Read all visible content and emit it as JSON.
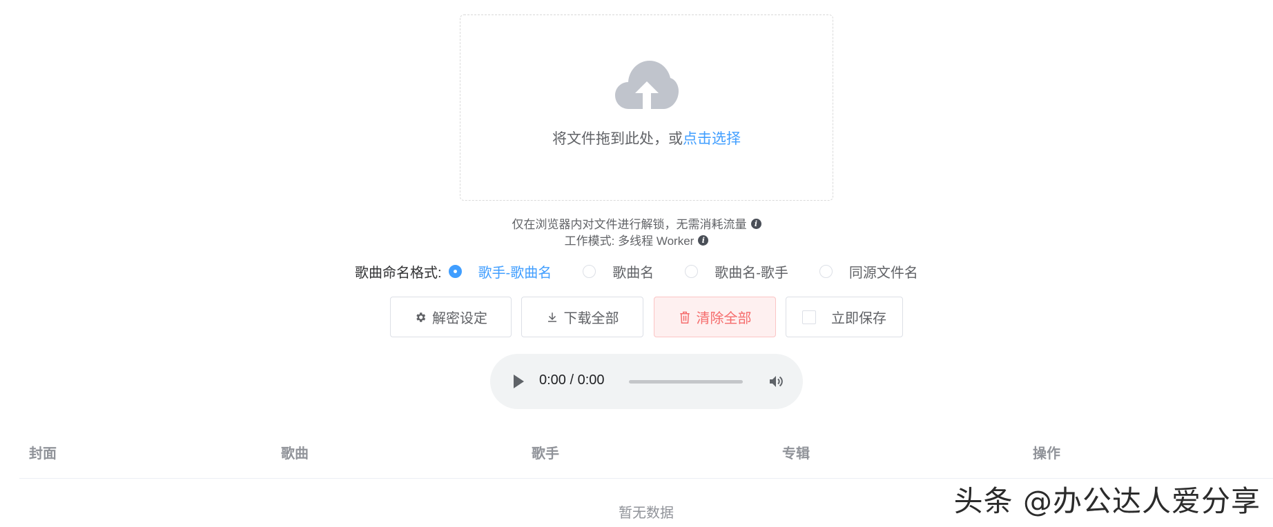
{
  "upload": {
    "icon": "cloud-upload-icon",
    "text_prefix": "将文件拖到此处，或",
    "link_text": "点击选择"
  },
  "info": {
    "line1": "仅在浏览器内对文件进行解锁，无需消耗流量",
    "line2": "工作模式: 多线程 Worker"
  },
  "naming": {
    "label": "歌曲命名格式:",
    "options": [
      {
        "label": "歌手-歌曲名",
        "checked": true
      },
      {
        "label": "歌曲名",
        "checked": false
      },
      {
        "label": "歌曲名-歌手",
        "checked": false
      },
      {
        "label": "同源文件名",
        "checked": false
      }
    ]
  },
  "buttons": {
    "settings": "解密设定",
    "download_all": "下载全部",
    "clear_all": "清除全部",
    "save_now": "立即保存"
  },
  "audio": {
    "time": "0:00 / 0:00"
  },
  "table": {
    "columns": [
      "封面",
      "歌曲",
      "歌手",
      "专辑",
      "操作"
    ],
    "empty_text": "暂无数据"
  },
  "watermark": "头条 @办公达人爱分享",
  "colors": {
    "primary": "#409eff",
    "danger": "#f56c6c",
    "danger_bg": "#fef0f0",
    "icon_gray": "#c0c4cc"
  }
}
